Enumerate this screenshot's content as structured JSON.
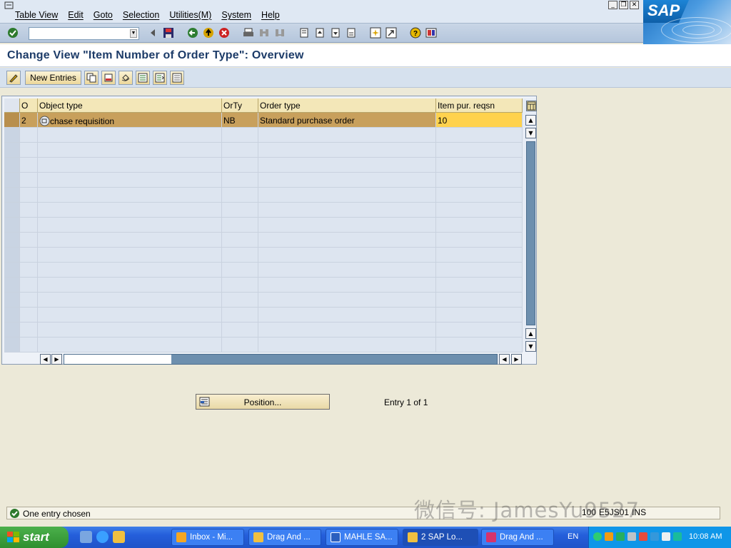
{
  "menubar": {
    "items": [
      "Table View",
      "Edit",
      "Goto",
      "Selection",
      "Utilities(M)",
      "System",
      "Help"
    ],
    "logo_text": "SAP"
  },
  "command_field": {
    "value": ""
  },
  "title": "Change View \"Item Number of Order Type\": Overview",
  "app_toolbar": {
    "new_entries_label": "New Entries"
  },
  "table": {
    "columns": [
      "O",
      "Object type",
      "OrTy",
      "Order type",
      "Item pur. reqsn"
    ],
    "rows": [
      {
        "sel": "",
        "o": "2",
        "object_type": "chase requisition",
        "orty": "NB",
        "order_type": "Standard purchase order",
        "item_pur_reqsn": "10"
      }
    ],
    "visible_row_count": 16
  },
  "position_button_label": "Position...",
  "entry_info": "Entry 1 of 1",
  "status": {
    "message": "One entry chosen",
    "client": "100",
    "server": "E5JS01",
    "mode": "INS"
  },
  "watermark": "微信号: JamesYu9527",
  "taskbar": {
    "start_label": "start",
    "tasks": [
      "Inbox - Mi...",
      "Drag And ...",
      "MAHLE SA...",
      "2 SAP Lo...",
      "Drag And ..."
    ],
    "language": "EN",
    "clock": "10:08 AM"
  },
  "colors": {
    "selected_row": "#c8a05c",
    "highlight_cell": "#ffd24d",
    "title_color": "#1c3b68",
    "header_bg": "#f3e7b8"
  }
}
